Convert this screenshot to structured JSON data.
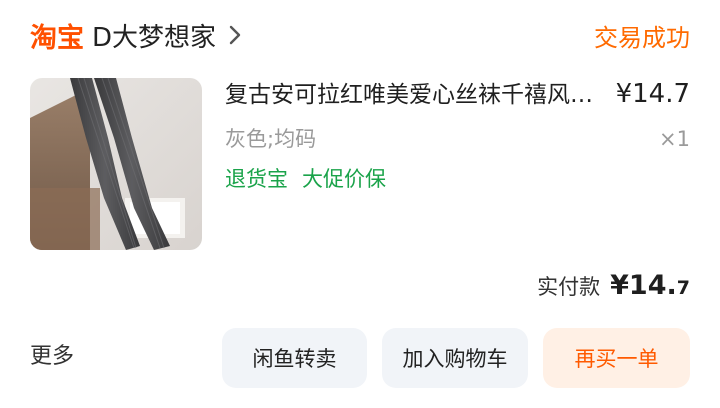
{
  "header": {
    "brand": "淘宝",
    "shop_name": "D大梦想家",
    "status": "交易成功"
  },
  "item": {
    "title": "复古安可拉红唯美爱心丝袜千禧风透明薄款黑丝袜子",
    "price": "¥14.7",
    "spec": "灰色;均码",
    "quantity": "×1",
    "tags": [
      "退货宝",
      "大促价保"
    ]
  },
  "payment": {
    "label": "实付款",
    "amount_main": "¥14.",
    "amount_cents": "7"
  },
  "footer": {
    "more_label": "更多",
    "buttons": {
      "xianyu": "闲鱼转卖",
      "cart": "加入购物车",
      "rebuy": "再买一单"
    }
  },
  "colors": {
    "brand": "#ff5000",
    "status": "#ff6a00",
    "tag_green": "#1aa34a",
    "rebuy_bg": "#fff0e5"
  },
  "icons": {
    "shop_link": "chevron-right-icon"
  }
}
